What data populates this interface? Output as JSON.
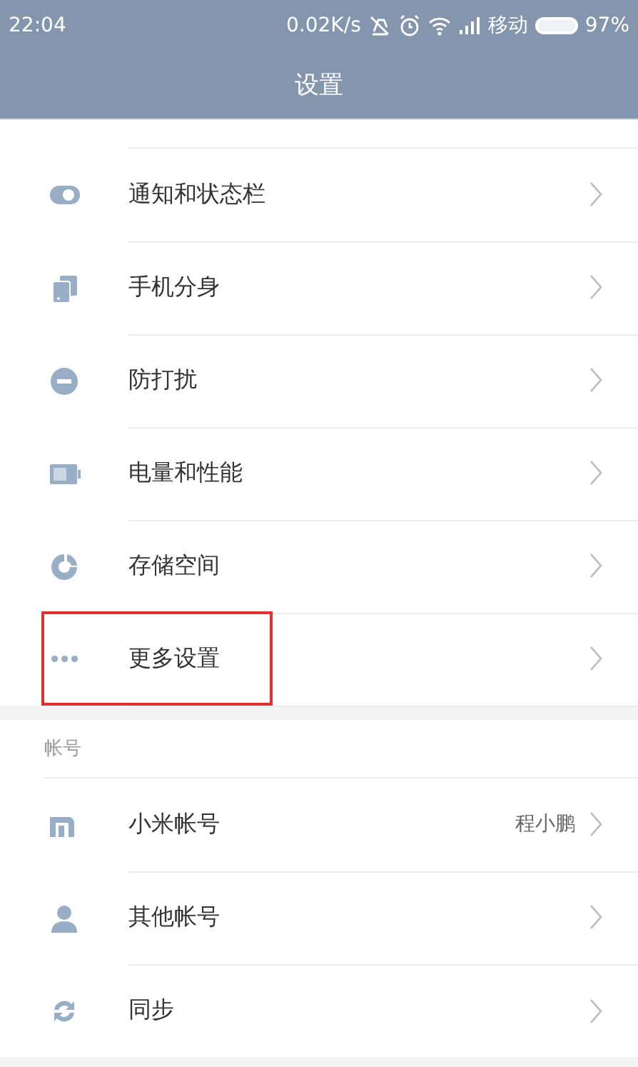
{
  "status_bar": {
    "time": "22:04",
    "speed": "0.02K/s",
    "carrier": "移动",
    "battery": "97%"
  },
  "header": {
    "title": "设置"
  },
  "sections": [
    {
      "items": [
        {
          "label": "通知和状态栏",
          "highlighted": false
        },
        {
          "label": "手机分身",
          "highlighted": false
        },
        {
          "label": "防打扰",
          "highlighted": false
        },
        {
          "label": "电量和性能",
          "highlighted": false
        },
        {
          "label": "存储空间",
          "highlighted": false
        },
        {
          "label": "更多设置",
          "highlighted": true
        }
      ]
    },
    {
      "title": "帐号",
      "items": [
        {
          "label": "小米帐号",
          "value": "程小鹏",
          "highlighted": false
        },
        {
          "label": "其他帐号",
          "highlighted": false
        },
        {
          "label": "同步",
          "highlighted": false
        }
      ]
    }
  ]
}
